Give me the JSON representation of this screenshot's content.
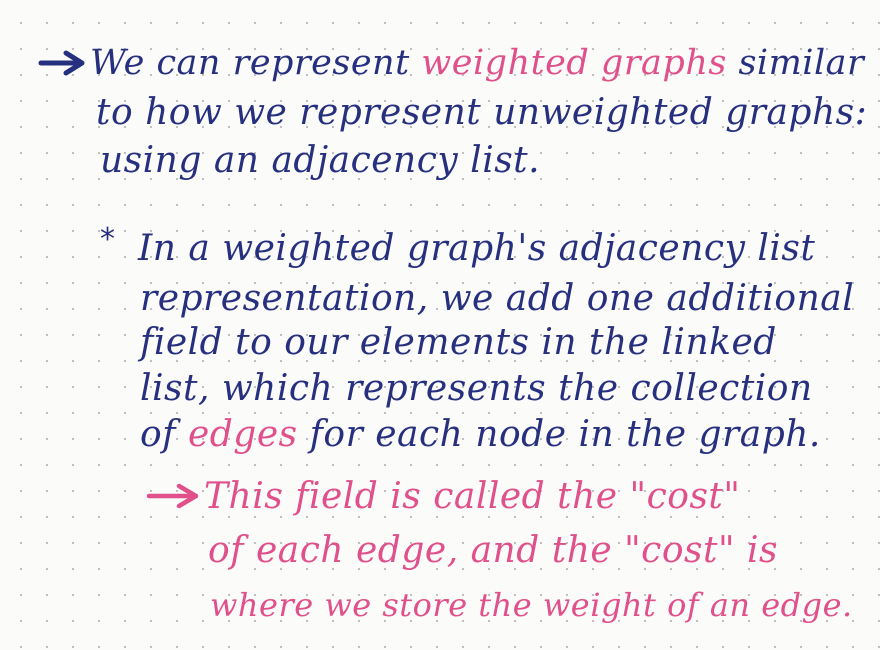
{
  "section1": {
    "line1_a": "We can represent ",
    "line1_hl": "weighted graphs",
    "line1_b": " similar",
    "line2": "to how we represent unweighted graphs:",
    "line3_a": "using an ",
    "line3_hl": "adjacency list",
    "line3_b": "."
  },
  "section2": {
    "star": "*",
    "line1": "In a weighted graph's adjacency list",
    "line2": "representation, we add one additional",
    "line3": "field to our elements in the linked",
    "line4": "list, which represents the collection",
    "line5_a": "of ",
    "line5_hl": "edges",
    "line5_b": " for each node in the graph."
  },
  "section3": {
    "line1": "This field is called the \"cost\"",
    "line2": "of each edge, and the \"cost\" is",
    "line3": "where we store the weight of an edge."
  },
  "colors": {
    "ink_blue": "#27307f",
    "ink_pink": "#e0508a",
    "paper": "#fbfbf9",
    "dots": "#b9b9b9"
  }
}
